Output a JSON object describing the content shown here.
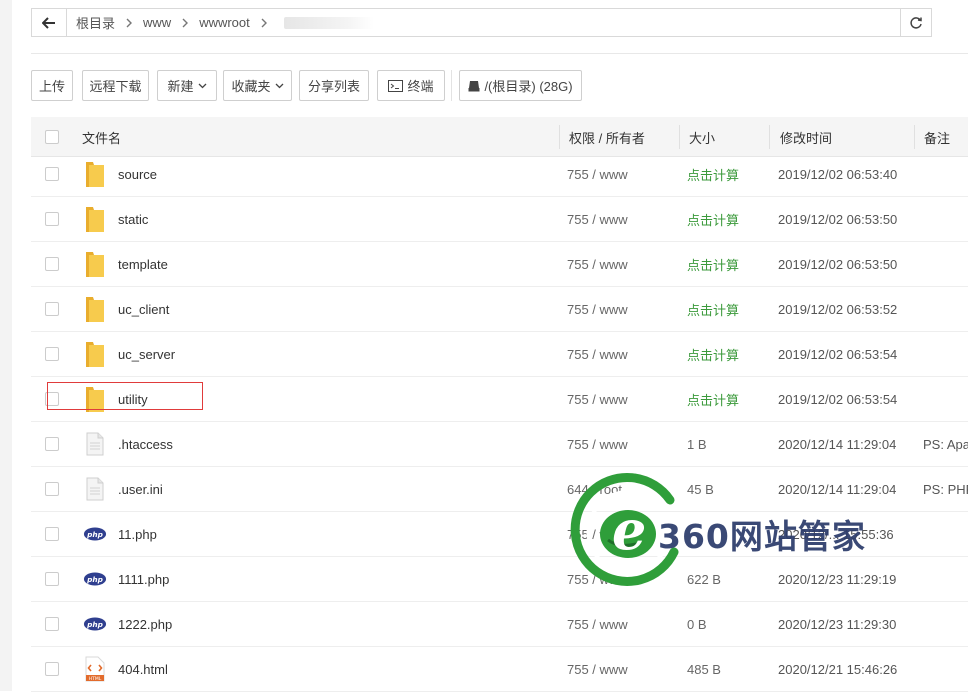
{
  "pathbar": {
    "back_icon": "arrow-left-icon",
    "crumbs": [
      "根目录",
      "www",
      "wwwroot"
    ],
    "refresh_icon": "refresh-icon"
  },
  "toolbar": {
    "upload": "上传",
    "remote_download": "远程下载",
    "new": "新建",
    "favorites": "收藏夹",
    "share_list": "分享列表",
    "terminal": "终端",
    "disk": "/(根目录) (28G)"
  },
  "table": {
    "headers": {
      "name": "文件名",
      "perm": "权限 / 所有者",
      "size": "大小",
      "mtime": "修改时间",
      "note": "备注"
    },
    "rows": [
      {
        "type": "folder",
        "name": "source",
        "perm": "755 / www",
        "size": "点击计算",
        "mtime": "2019/12/02 06:53:40",
        "note": ""
      },
      {
        "type": "folder",
        "name": "static",
        "perm": "755 / www",
        "size": "点击计算",
        "mtime": "2019/12/02 06:53:50",
        "note": ""
      },
      {
        "type": "folder",
        "name": "template",
        "perm": "755 / www",
        "size": "点击计算",
        "mtime": "2019/12/02 06:53:50",
        "note": ""
      },
      {
        "type": "folder",
        "name": "uc_client",
        "perm": "755 / www",
        "size": "点击计算",
        "mtime": "2019/12/02 06:53:52",
        "note": ""
      },
      {
        "type": "folder",
        "name": "uc_server",
        "perm": "755 / www",
        "size": "点击计算",
        "mtime": "2019/12/02 06:53:54",
        "note": ""
      },
      {
        "type": "folder",
        "name": "utility",
        "perm": "755 / www",
        "size": "点击计算",
        "mtime": "2019/12/02 06:53:54",
        "note": ""
      },
      {
        "type": "file",
        "name": ".htaccess",
        "perm": "755 / www",
        "size": "1 B",
        "mtime": "2020/12/14 11:29:04",
        "note": "PS: Apa"
      },
      {
        "type": "file",
        "name": ".user.ini",
        "perm": "644 / root",
        "size": "45 B",
        "mtime": "2020/12/14 11:29:04",
        "note": "PS: PHP"
      },
      {
        "type": "php",
        "name": "11.php",
        "perm": "755 / www",
        "size": "",
        "mtime": "2020/12/... 15:55:36",
        "note": ""
      },
      {
        "type": "php",
        "name": "1111.php",
        "perm": "755 / www",
        "size": "622 B",
        "mtime": "2020/12/23 11:29:19",
        "note": ""
      },
      {
        "type": "php",
        "name": "1222.php",
        "perm": "755 / www",
        "size": "0 B",
        "mtime": "2020/12/23 11:29:30",
        "note": ""
      },
      {
        "type": "html",
        "name": "404.html",
        "perm": "755 / www",
        "size": "485 B",
        "mtime": "2020/12/21 15:46:26",
        "note": ""
      }
    ]
  },
  "watermark": {
    "text": "360网站管家",
    "logo_letter": "e"
  },
  "colors": {
    "folder": "#f5c242",
    "calc_link": "#3b9a3b",
    "highlight": "#e03b3b",
    "php_badge": "#2f3f8f"
  }
}
